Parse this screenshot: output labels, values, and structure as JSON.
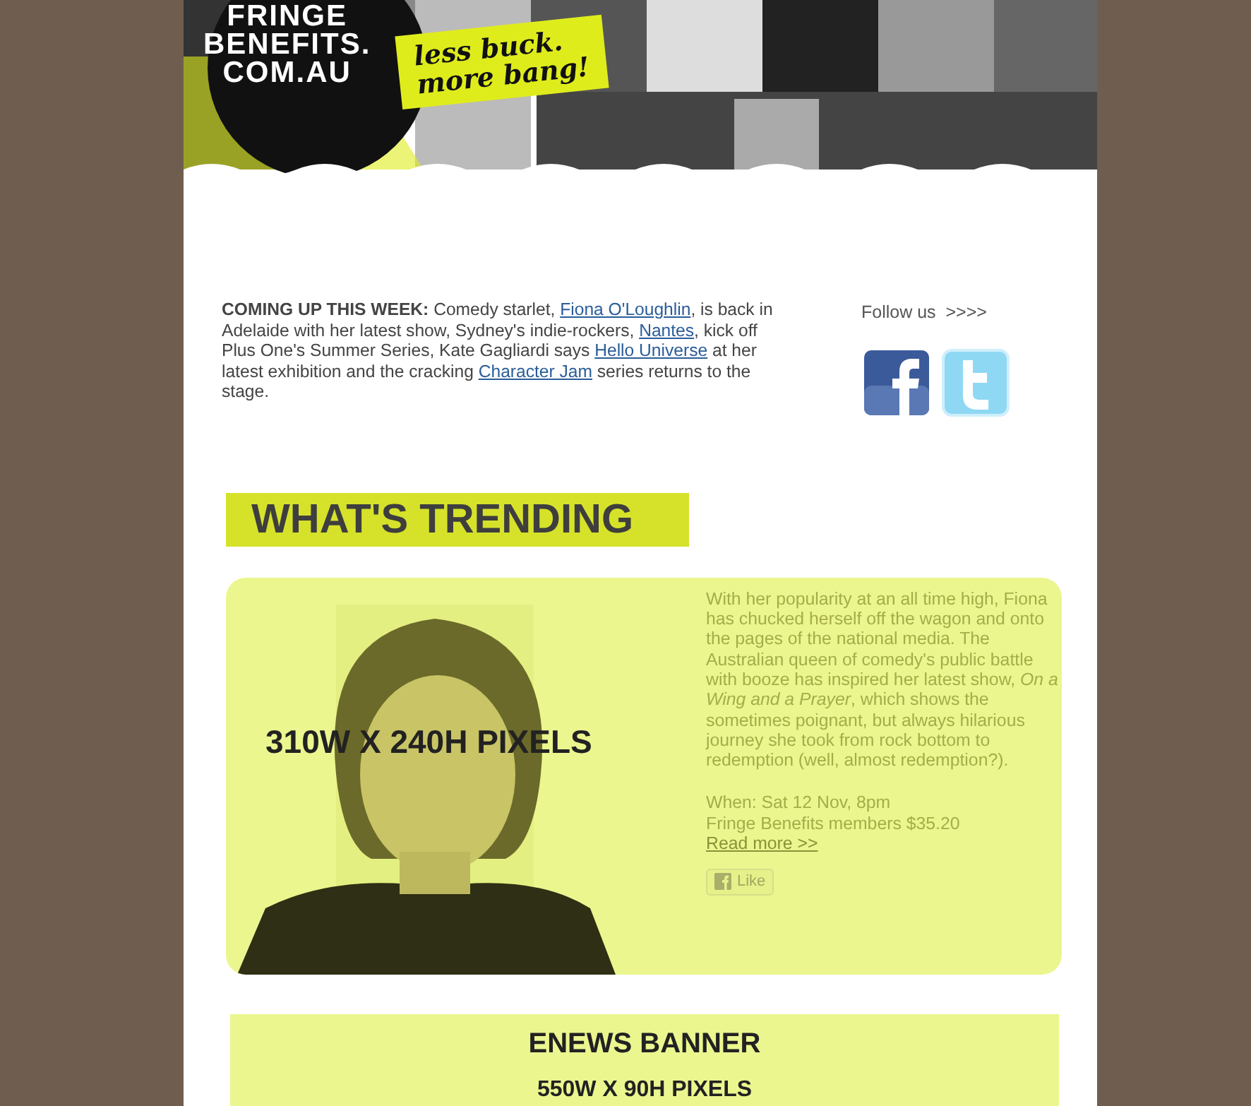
{
  "header": {
    "logo_lines": [
      "FRINGE",
      "BENEFITS.",
      "COM.AU"
    ],
    "slogan_lines": [
      "less buck.",
      "more bang!"
    ]
  },
  "intro": {
    "text": "**COMING UP THIS WEEK:**  Comedy starlet, ",
    "parts": [
      {
        "kind": "link",
        "text": "Fiona O'Loughlin"
      },
      {
        "kind": "text",
        "text": ", is back in Adelaide with her latest show, Sydney's indie-rockers, "
      },
      {
        "kind": "link",
        "text": "Nantes"
      },
      {
        "kind": "text",
        "text": ", kick off Plus One's Summer Series, Kate Gagliardi says "
      },
      {
        "kind": "link",
        "text": "Hello Universe"
      },
      {
        "kind": "text",
        "text": " at her latest exhibition and the cracking "
      },
      {
        "kind": "link",
        "text": "Character Jam"
      },
      {
        "kind": "text",
        "text": " series returns to the stage."
      }
    ]
  },
  "follow": {
    "label": "Follow us  >>>>",
    "networks": [
      {
        "kind": "facebook"
      },
      {
        "kind": "twitter"
      }
    ]
  },
  "trending": {
    "heading": "WHAT'S TRENDING",
    "feature": {
      "image": {
        "kind": "picture",
        "overlay": "310W X 240H PIXELS"
      },
      "body": "With her popularity at an all time high, Fiona has chucked herself off the wagon and onto the pages of the national media. The Australian queen of comedy's public battle with booze has inspired her latest show, *On a Wing and a Prayer*, which shows the sometimes poignant, but always hilarious journey she took from rock bottom to redemption (well, almost redemption?).",
      "when": "When: Sat 12 Nov, 8pm",
      "price": "Fringe Benefits members $35.20",
      "read_more": "Read more >>",
      "like": "Like"
    }
  },
  "banner": {
    "title": "ENEWS BANNER",
    "size": "550W X 90H PIXELS"
  }
}
